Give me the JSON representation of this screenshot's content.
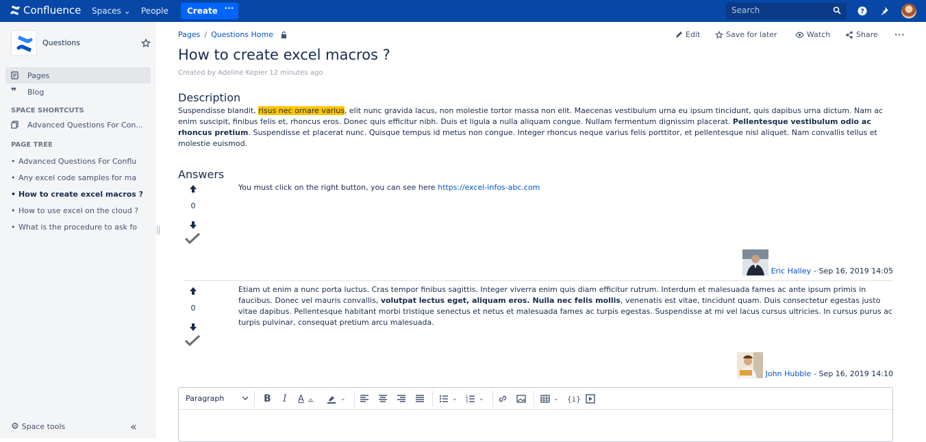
{
  "app": {
    "logo_text": "Confluence",
    "nav": [
      "Spaces",
      "People"
    ],
    "create_label": "Create",
    "create_more": "···",
    "search_placeholder": "Search"
  },
  "sidebar": {
    "space_name": "Questions",
    "items": [
      {
        "label": "Pages",
        "icon": "pages-icon"
      },
      {
        "label": "Blog",
        "icon": "quote-icon"
      }
    ],
    "shortcuts_heading": "SPACE SHORTCUTS",
    "shortcut": "Advanced Questions For Con...",
    "tree_heading": "PAGE TREE",
    "tree": [
      "Advanced Questions For Conflu",
      "Any excel code samples for ma",
      "How to create excel macros ?",
      "How to use excel on the cloud ?",
      "What is the procedure to ask fo"
    ],
    "space_tools": "Space tools"
  },
  "breadcrumb": [
    "Pages",
    "Questions Home"
  ],
  "actions": {
    "edit": "Edit",
    "save": "Save for later",
    "watch": "Watch",
    "share": "Share"
  },
  "page": {
    "title": "How to create excel macros ?",
    "byline": "Created by Adeline Kepler 12 minutes ago",
    "description_heading": "Description",
    "description": {
      "p1": "Suspendisse blandit, ",
      "highlight": "risus nec ornare varius",
      "p2": ", elit nunc gravida lacus, non molestie tortor massa non elit. Maecenas vestibulum urna eu ipsum tincidunt, quis dapibus urna dictum. Nam ac enim suscipit, finibus felis et, rhoncus eros. Donec quis efficitur nibh. Duis et ligula a nulla aliquam congue. Nullam fermentum dignissim placerat. ",
      "bold": "Pellentesque vestibulum odio ac rhoncus pretium",
      "p3": ". Suspendisse et placerat nunc. Quisque tempus id metus non congue. Integer rhoncus neque varius felis porttitor, et pellentesque nisl aliquet. Nam convallis tellus et molestie euismod."
    },
    "answers_heading": "Answers"
  },
  "answers": [
    {
      "votes": "0",
      "text": "You must click on the right button, you can see here ",
      "link": "https://excel-infos-abc.com",
      "author": "Eric Halley",
      "date": " - Sep 16, 2019 14:05"
    },
    {
      "votes": "0",
      "p1": "Etiam ut enim a nunc porta luctus. Cras tempor finibus sagittis. Integer viverra enim quis diam efficitur rutrum. Interdum et malesuada fames ac ante ipsum primis in faucibus. Donec vel mauris convallis, ",
      "bold": "volutpat lectus eget, aliquam eros. Nulla nec felis mollis",
      "p2": ", venenatis est vitae, tincidunt quam. Duis consectetur egestas justo vitae dapibus. Pellentesque habitant morbi tristique senectus et netus et malesuada fames ac turpis egestas. Suspendisse at mi vel lacus cursus ultricies. In cursus purus ac turpis pulvinar, consequat pretium arcu malesuada.",
      "author": "John Hubble",
      "date": " - Sep 16, 2019 14:10"
    }
  ],
  "editor": {
    "format": "Paragraph"
  },
  "colors": {
    "nav": "#0747a6",
    "create": "#0065ff",
    "link": "#0052cc",
    "highlight": "#ffc400",
    "sidebar": "#f4f5f7"
  }
}
